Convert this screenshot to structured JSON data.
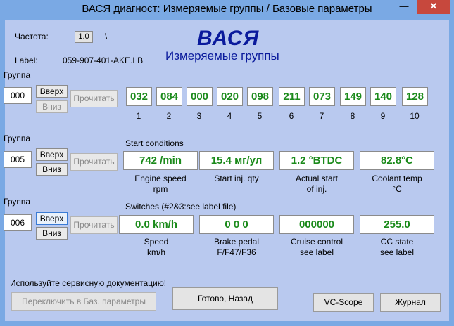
{
  "window": {
    "title": "ВАСЯ диагност: Измеряемые группы / Базовые параметры",
    "min_symbol": "—",
    "close_symbol": "✕"
  },
  "header": {
    "freq_label": "Частота:",
    "freq_value": "1.0",
    "freq_sep": "\\",
    "label_label": "Label:",
    "label_value": "059-907-401-AKE.LB",
    "brand": "ВАСЯ",
    "subtitle": "Измеряемые группы"
  },
  "groups": [
    {
      "label": "Группа",
      "number": "000",
      "up": "Вверх",
      "down": "Вниз",
      "read": "Прочитать",
      "values": [
        "032",
        "084",
        "000",
        "020",
        "098",
        "211",
        "073",
        "149",
        "140",
        "128"
      ],
      "indices": [
        "1",
        "2",
        "3",
        "4",
        "5",
        "6",
        "7",
        "8",
        "9",
        "10"
      ]
    },
    {
      "label": "Группа",
      "number": "005",
      "up": "Вверх",
      "down": "Вниз",
      "read": "Прочитать",
      "heading": "Start conditions",
      "values": [
        "742 /min",
        "15.4 мг/ул",
        "1.2 °BTDC",
        "82.8°C"
      ],
      "captions": [
        [
          "Engine speed",
          "rpm"
        ],
        [
          "Start inj. qty",
          ""
        ],
        [
          "Actual start",
          "of inj."
        ],
        [
          "Coolant temp",
          "°C"
        ]
      ]
    },
    {
      "label": "Группа",
      "number": "006",
      "up": "Вверх",
      "down": "Вниз",
      "read": "Прочитать",
      "heading": "Switches (#2&3:see label file)",
      "values": [
        "0.0 km/h",
        "0  0  0",
        "000000",
        "255.0"
      ],
      "captions": [
        [
          "Speed",
          "km/h"
        ],
        [
          "Brake pedal",
          "F/F47/F36"
        ],
        [
          "Cruise control",
          "see label"
        ],
        [
          "CC state",
          "see label"
        ]
      ]
    }
  ],
  "footer": {
    "notice": "Используйте сервисную документацию!",
    "switch_btn": "Переключить в Баз. параметры",
    "done_btn": "Готово, Назад",
    "scope_btn": "VC-Scope",
    "log_btn": "Журнал"
  },
  "colors": {
    "value_text": "#1a8a1a",
    "brand": "#0a1a9c",
    "panel_bg": "#b9c9ef",
    "frame": "#7aa9e4"
  }
}
